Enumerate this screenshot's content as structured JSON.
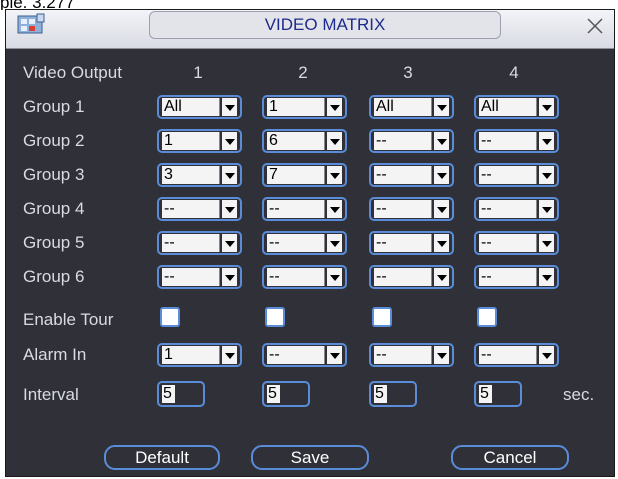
{
  "page_caption": "ple. 3.277",
  "window": {
    "title": "VIDEO MATRIX"
  },
  "header": {
    "label": "Video Output",
    "cols": [
      "1",
      "2",
      "3",
      "4"
    ]
  },
  "groups": [
    {
      "label": "Group 1",
      "values": [
        "All",
        "1",
        "All",
        "All"
      ]
    },
    {
      "label": "Group 2",
      "values": [
        "1",
        "6",
        "--",
        "--"
      ]
    },
    {
      "label": "Group 3",
      "values": [
        "3",
        "7",
        "--",
        "--"
      ]
    },
    {
      "label": "Group 4",
      "values": [
        "--",
        "--",
        "--",
        "--"
      ]
    },
    {
      "label": "Group 5",
      "values": [
        "--",
        "--",
        "--",
        "--"
      ]
    },
    {
      "label": "Group 6",
      "values": [
        "--",
        "--",
        "--",
        "--"
      ]
    }
  ],
  "tour": {
    "label": "Enable Tour",
    "checked": [
      false,
      false,
      false,
      false
    ]
  },
  "alarm": {
    "label": "Alarm In",
    "values": [
      "1",
      "--",
      "--",
      "--"
    ]
  },
  "interval": {
    "label": "Interval",
    "values": [
      "5",
      "5",
      "5",
      "5"
    ],
    "unit": "sec."
  },
  "buttons": {
    "default": "Default",
    "save": "Save",
    "cancel": "Cancel"
  },
  "colors": {
    "panel": "#2f3038",
    "accent_border": "#5a8cd8",
    "title_text": "#1e2a8c"
  },
  "icons": {
    "app": "matrix-app-icon",
    "close": "close-icon"
  }
}
